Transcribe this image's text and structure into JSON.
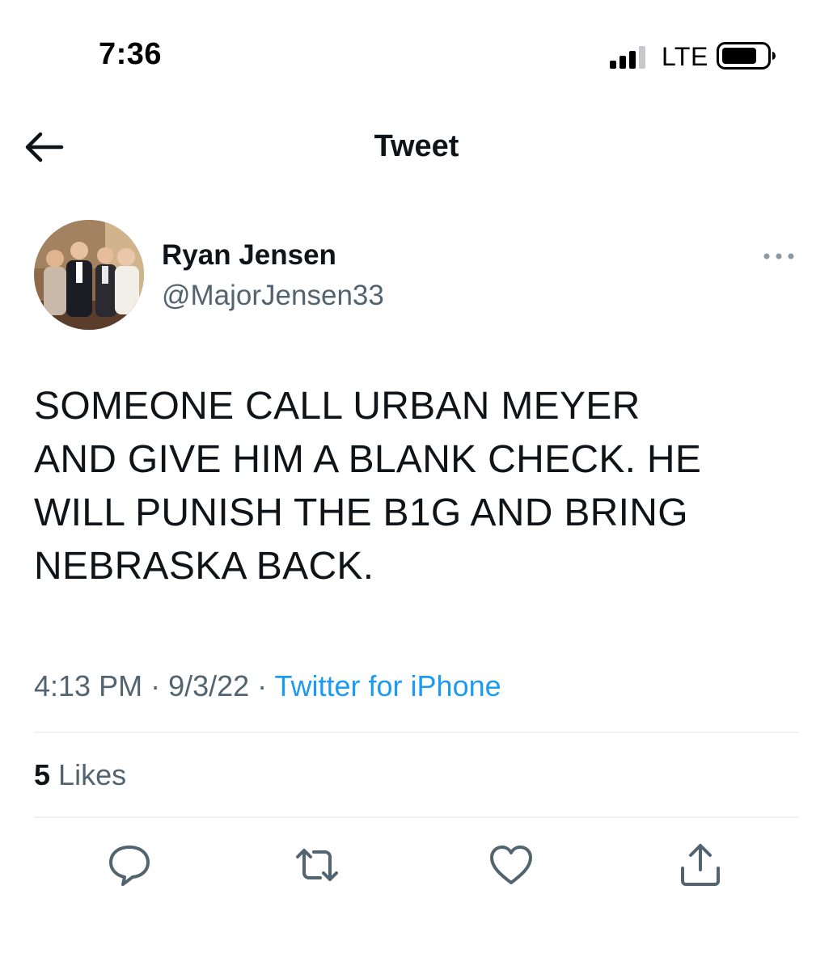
{
  "status_bar": {
    "time": "7:36",
    "network": "LTE",
    "icons": [
      "signal-icon",
      "battery-icon"
    ]
  },
  "header": {
    "title": "Tweet",
    "back_icon": "arrow-left-icon"
  },
  "author": {
    "display_name": "Ryan Jensen",
    "handle": "@MajorJensen33"
  },
  "tweet": {
    "text": "SOMEONE CALL URBAN MEYER\nAND GIVE HIM A BLANK CHECK. HE\nWILL PUNISH THE B1G AND BRING\nNEBRASKA BACK.",
    "time": "4:13 PM",
    "separator": " · ",
    "date": "9/3/22",
    "source": "Twitter for iPhone"
  },
  "stats": {
    "likes_count": "5",
    "likes_label": "Likes"
  },
  "actions": [
    {
      "name": "reply",
      "icon": "reply-icon"
    },
    {
      "name": "retweet",
      "icon": "retweet-icon"
    },
    {
      "name": "like",
      "icon": "heart-icon"
    },
    {
      "name": "share",
      "icon": "share-icon"
    }
  ],
  "colors": {
    "text_primary": "#0f1419",
    "text_secondary": "#536471",
    "link": "#1d9bf0",
    "divider": "#eff3f4"
  }
}
